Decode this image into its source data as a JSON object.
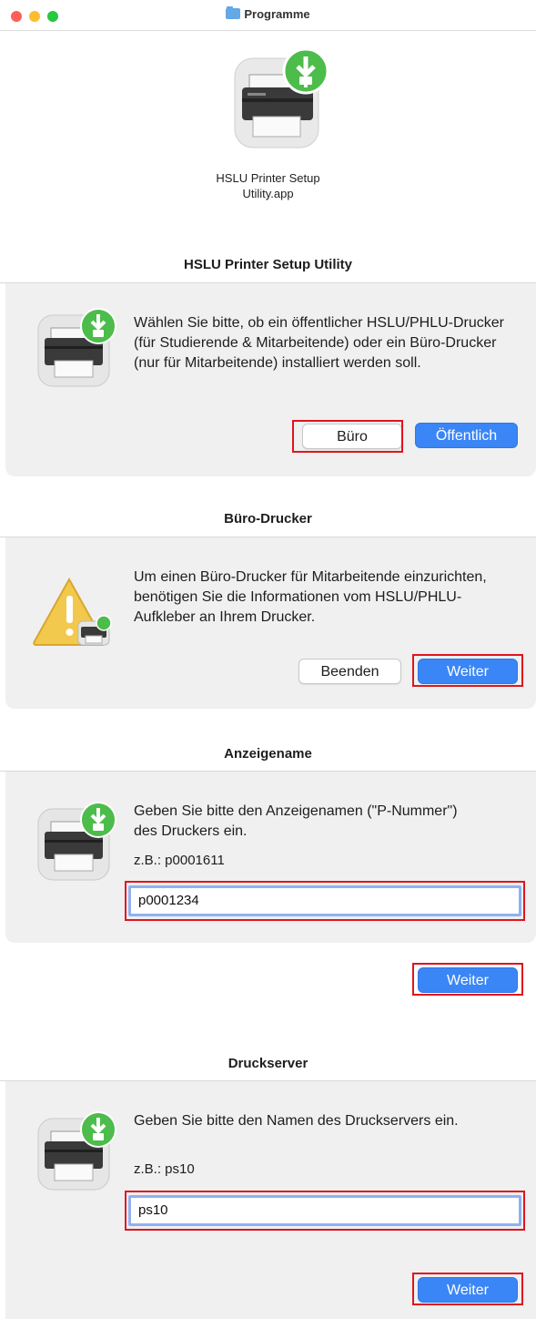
{
  "window": {
    "title": "Programme",
    "traffic_colors": {
      "close": "#ff5f57",
      "minimize": "#febc2e",
      "zoom": "#28c840"
    }
  },
  "app_icon": {
    "caption_line1": "HSLU Printer Setup",
    "caption_line2": "Utility.app",
    "icon": "printer-download-icon"
  },
  "dialogs": {
    "setup": {
      "title": "HSLU Printer Setup Utility",
      "message": "Wählen Sie bitte, ob ein öffentlicher HSLU/PHLU-Drucker (für Studierende & Mitarbeitende) oder ein Büro-Drucker (nur für Mitarbeitende) installiert werden soll.",
      "buttons": {
        "secondary": "Büro",
        "primary": "Öffentlich"
      },
      "icon": "printer-download-icon"
    },
    "office": {
      "title": "Büro-Drucker",
      "message": "Um einen Büro-Drucker für Mitarbeitende einzurichten, benötigen Sie die Informationen vom HSLU/PHLU-Aufkleber an Ihrem Drucker.",
      "buttons": {
        "secondary": "Beenden",
        "primary": "Weiter"
      },
      "icon": "warning-icon"
    },
    "display_name": {
      "title": "Anzeigename",
      "message": "Geben Sie bitte den Anzeigenamen (\"P-Nummer\") des Druckers ein.",
      "example": "z.B.: p0001611",
      "input_value": "p0001234",
      "buttons": {
        "primary": "Weiter"
      },
      "icon": "printer-download-icon"
    },
    "print_server": {
      "title": "Druckserver",
      "message": "Geben Sie bitte den Namen des Druckservers ein.",
      "example": "z.B.: ps10",
      "input_value": "ps10",
      "buttons": {
        "primary": "Weiter"
      },
      "icon": "printer-download-icon"
    }
  },
  "colors": {
    "accent": "#3b86f6",
    "highlight": "#e0141e",
    "panel": "#f0f0f0"
  }
}
